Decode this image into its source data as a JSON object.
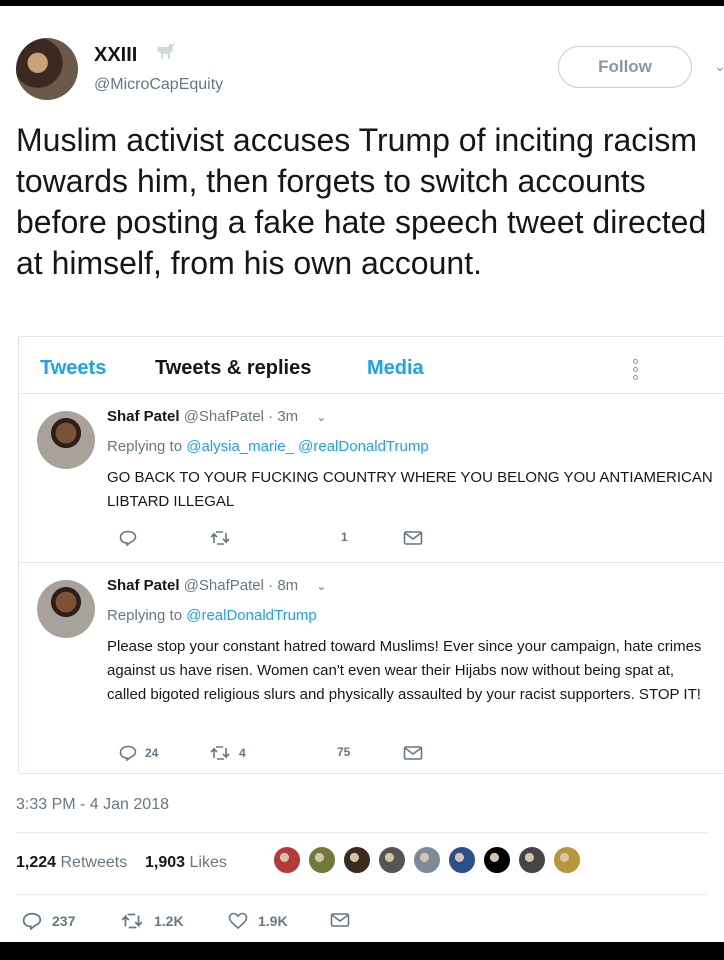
{
  "author": {
    "display_name": "XXIII",
    "handle": "@MicroCapEquity",
    "name_icon": "goat-icon"
  },
  "follow_label": "Follow",
  "tweet_text": "Muslim activist accuses Trump of inciting racism towards him, then forgets to switch accounts before posting a fake hate speech tweet directed at himself, from his own account.",
  "embedded": {
    "tabs": [
      "Tweets",
      "Tweets & replies",
      "Media"
    ],
    "replies": [
      {
        "name": "Shaf Patel",
        "handle": "@ShafPatel",
        "time": "· 3m",
        "replying_prefix": "Replying to ",
        "mentions": "@alysia_marie_ @realDonaldTrump",
        "text": "GO BACK TO YOUR FUCKING COUNTRY WHERE YOU BELONG YOU ANTIAMERICAN LIBTARD ILLEGAL",
        "reply_count": "",
        "retweet_count": "",
        "like_count": "1"
      },
      {
        "name": "Shaf Patel",
        "handle": "@ShafPatel",
        "time": "· 8m",
        "replying_prefix": "Replying to ",
        "mentions": "@realDonaldTrump",
        "text": "Please stop your constant hatred toward Muslims! Ever since your campaign, hate crimes against us have risen. Women can't even wear their Hijabs now without being spat at, called bigoted religious slurs and physically assaulted by your racist supporters. STOP IT!",
        "reply_count": "24",
        "retweet_count": "4",
        "like_count": "75"
      }
    ]
  },
  "timestamp": "3:33 PM - 4 Jan 2018",
  "stats": {
    "retweets": "1,224",
    "retweets_label": "Retweets",
    "likes": "1,903",
    "likes_label": "Likes"
  },
  "liker_colors": [
    "#b23a3a",
    "#6f7a3a",
    "#3b2a1e",
    "#555555",
    "#7d8a99",
    "#2a4f8a",
    "#000000",
    "#444444",
    "#b8963e"
  ],
  "actions": {
    "replies": "237",
    "retweets": "1.2K",
    "likes": "1.9K"
  }
}
